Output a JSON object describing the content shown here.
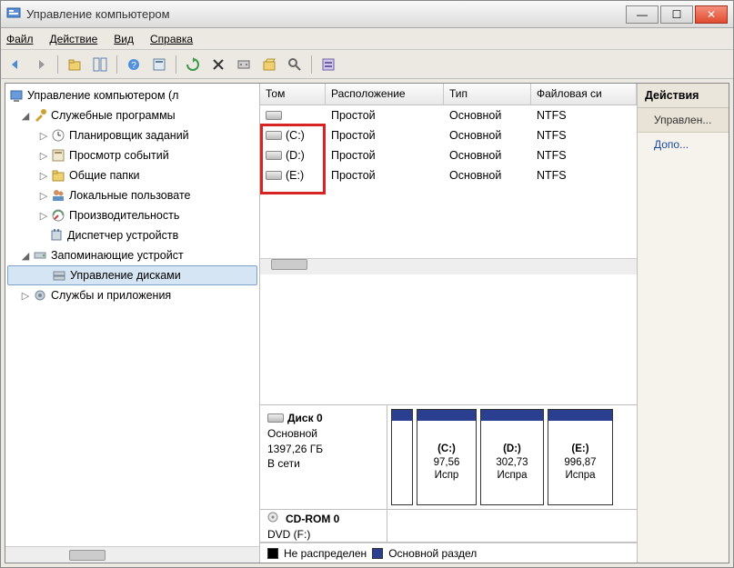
{
  "window": {
    "title": "Управление компьютером"
  },
  "menu": {
    "file": "Файл",
    "action": "Действие",
    "view": "Вид",
    "help": "Справка"
  },
  "tree": {
    "root": "Управление компьютером (л",
    "services_apps": "Службы и приложения",
    "system_tools": "Служебные программы",
    "items": {
      "task_scheduler": "Планировщик заданий",
      "event_viewer": "Просмотр событий",
      "shared_folders": "Общие папки",
      "local_users": "Локальные пользовате",
      "performance": "Производительность",
      "device_manager": "Диспетчер устройств"
    },
    "storage": "Запоминающие устройст",
    "disk_mgmt": "Управление дисками"
  },
  "grid": {
    "headers": {
      "volume": "Том",
      "layout": "Расположение",
      "type": "Тип",
      "filesystem": "Файловая си"
    },
    "rows": [
      {
        "vol": "",
        "layout": "Простой",
        "type": "Основной",
        "fs": "NTFS"
      },
      {
        "vol": "(C:)",
        "layout": "Простой",
        "type": "Основной",
        "fs": "NTFS"
      },
      {
        "vol": "(D:)",
        "layout": "Простой",
        "type": "Основной",
        "fs": "NTFS"
      },
      {
        "vol": "(E:)",
        "layout": "Простой",
        "type": "Основной",
        "fs": "NTFS"
      }
    ]
  },
  "disk0": {
    "name": "Диск 0",
    "type": "Основной",
    "size": "1397,26 ГБ",
    "status": "В сети",
    "parts": [
      {
        "label": "",
        "size": "",
        "status": ""
      },
      {
        "label": "(C:)",
        "size": "97,56",
        "status": "Испр"
      },
      {
        "label": "(D:)",
        "size": "302,73",
        "status": "Испра"
      },
      {
        "label": "(E:)",
        "size": "996,87",
        "status": "Испра"
      }
    ]
  },
  "cdrom": {
    "name": "CD-ROM 0",
    "sub": "DVD (F:)"
  },
  "legend": {
    "unalloc": "Не распределен",
    "primary": "Основной раздел"
  },
  "actions": {
    "header": "Действия",
    "item1": "Управлен...",
    "item2": "Допо..."
  }
}
